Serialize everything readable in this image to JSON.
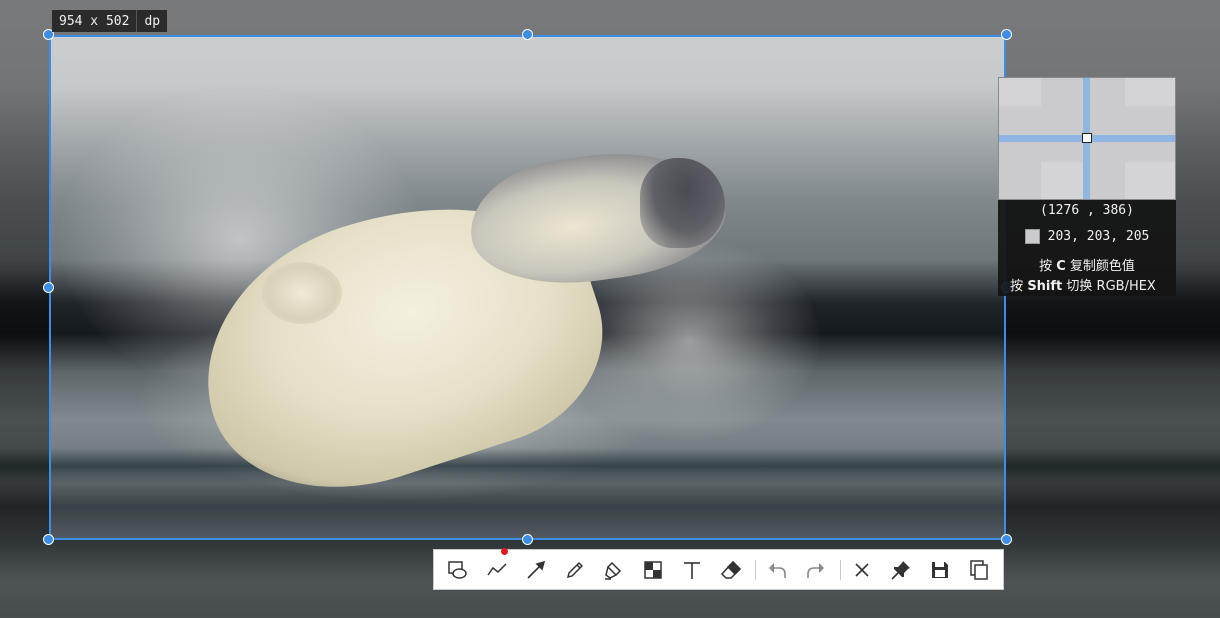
{
  "selection": {
    "size_value": "954 x 502",
    "size_unit": "dp"
  },
  "magnifier": {
    "coordinates": "(1276 , 386)",
    "color_value": "203, 203, 205",
    "color_hex": "#cbcbcd",
    "hint_copy": {
      "prefix": "按",
      "key": "C",
      "suffix": "复制颜色值"
    },
    "hint_switch": {
      "prefix": "按",
      "key": "Shift",
      "suffix": "切换 RGB/HEX"
    }
  },
  "toolbar": {
    "tools": [
      {
        "name": "shape-tool",
        "icon": "shape-icon"
      },
      {
        "name": "polyline-tool",
        "icon": "polyline-icon"
      },
      {
        "name": "arrow-tool",
        "icon": "arrow-icon"
      },
      {
        "name": "pen-tool",
        "icon": "pen-icon"
      },
      {
        "name": "marker-tool",
        "icon": "marker-icon"
      },
      {
        "name": "mosaic-tool",
        "icon": "mosaic-icon"
      },
      {
        "name": "text-tool",
        "icon": "text-icon"
      },
      {
        "name": "eraser-tool",
        "icon": "eraser-icon"
      },
      {
        "name": "undo",
        "icon": "undo-icon"
      },
      {
        "name": "redo",
        "icon": "redo-icon"
      },
      {
        "name": "close",
        "icon": "close-icon"
      },
      {
        "name": "pin",
        "icon": "pin-icon"
      },
      {
        "name": "save",
        "icon": "save-icon"
      },
      {
        "name": "copy",
        "icon": "copy-icon"
      }
    ],
    "accent_color": "#3c8de8",
    "active_dot_color": "#e0191b"
  }
}
